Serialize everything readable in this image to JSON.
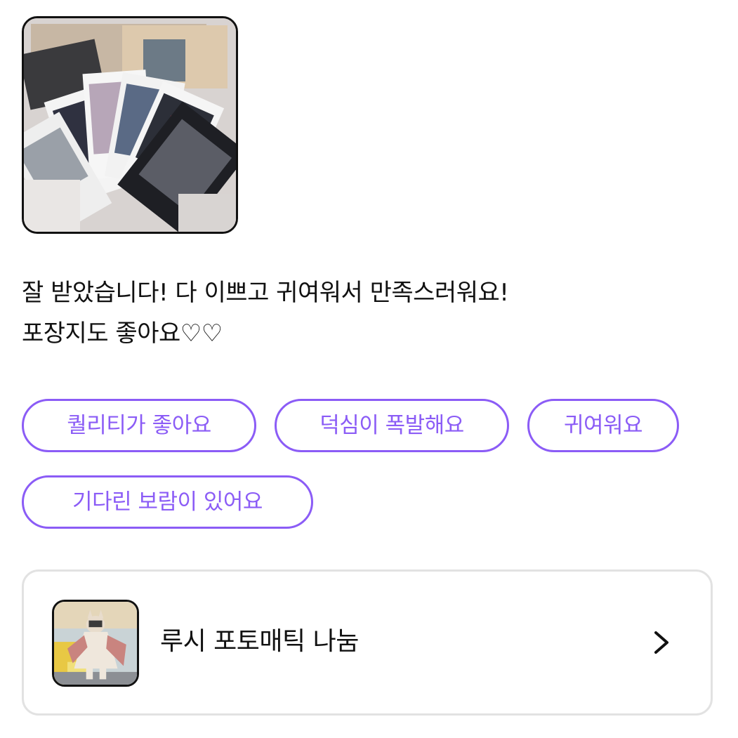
{
  "review": {
    "text": "잘 받았습니다! 다 이쁘고 귀여워서 만족스러워요!\n포장지도  좋아요♡♡",
    "photo_icon": "review-photo"
  },
  "tags": [
    {
      "label": "퀄리티가 좋아요"
    },
    {
      "label": "덕심이 폭발해요"
    },
    {
      "label": "귀여워요"
    },
    {
      "label": "기다린 보람이 있어요"
    }
  ],
  "colors": {
    "accent": "#8b5cf6",
    "card_border": "#e2e2e2",
    "text": "#111111"
  },
  "product": {
    "title": "루시 포토매틱 나눔",
    "arrow_icon": "chevron-right-icon"
  }
}
